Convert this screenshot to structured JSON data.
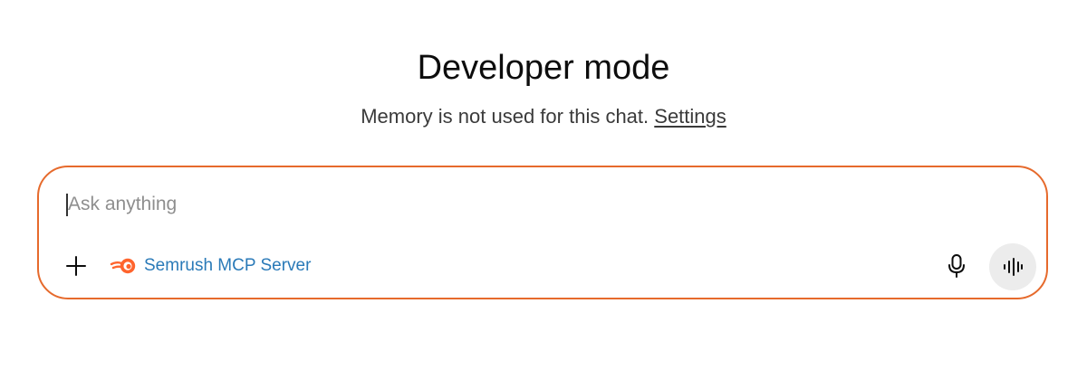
{
  "header": {
    "title": "Developer mode",
    "subtitle_text": "Memory is not used for this chat.",
    "settings_link": "Settings"
  },
  "composer": {
    "placeholder": "Ask anything",
    "value": "",
    "tool_label": "Semrush MCP Server",
    "colors": {
      "border": "#e66a2c",
      "tool_text": "#2a7ab8",
      "tool_icon": "#ff642d",
      "voice_bg": "#ececec"
    },
    "icons": {
      "add": "plus-icon",
      "tool": "semrush-logo-icon",
      "mic": "microphone-icon",
      "voice": "voice-waveform-icon"
    }
  }
}
